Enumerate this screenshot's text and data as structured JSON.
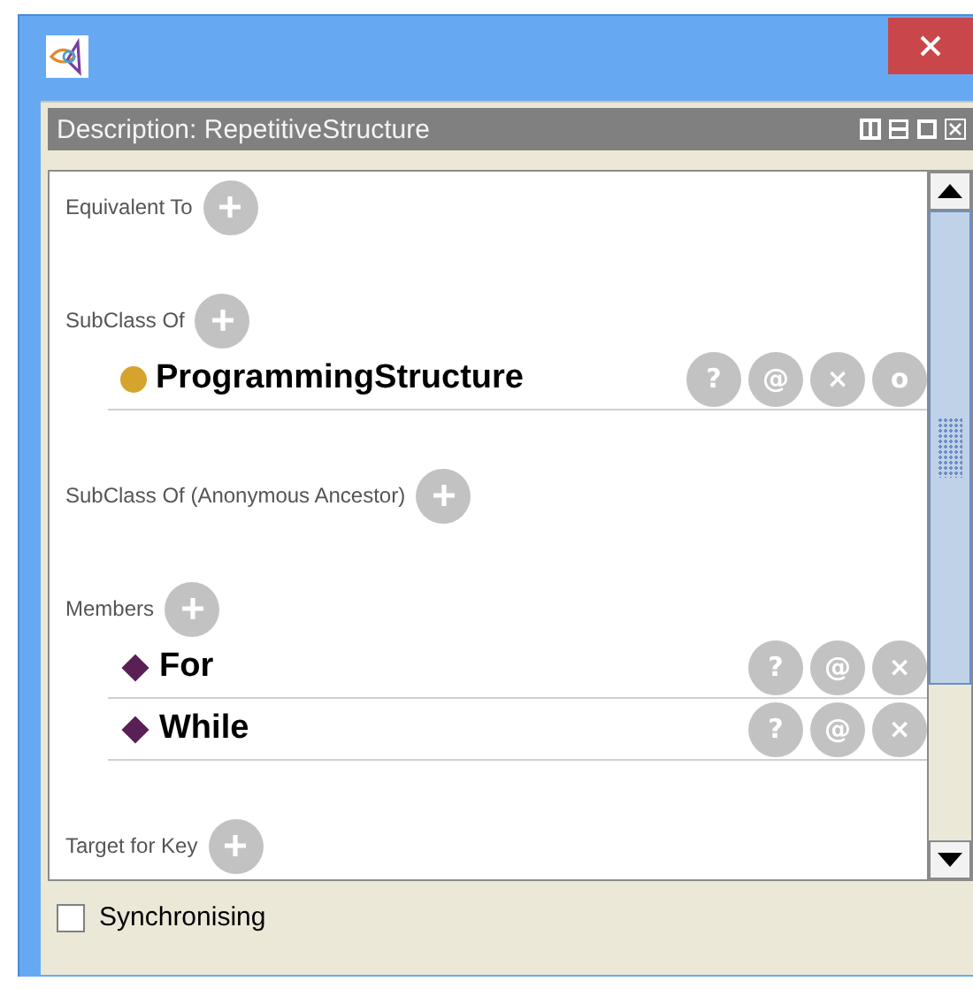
{
  "panel": {
    "title": "Description: RepetitiveStructure"
  },
  "sections": [
    {
      "title": "Equivalent To"
    },
    {
      "title": "SubClass Of",
      "items": [
        {
          "kind": "class",
          "label": "ProgrammingStructure",
          "color": "#d4a42c",
          "buttons": [
            "?",
            "@",
            "×",
            "o"
          ]
        }
      ]
    },
    {
      "title": "SubClass Of (Anonymous Ancestor)"
    },
    {
      "title": "Members",
      "items": [
        {
          "kind": "individual",
          "label": "For",
          "color": "#5a1f55",
          "buttons": [
            "?",
            "@",
            "×"
          ]
        },
        {
          "kind": "individual",
          "label": "While",
          "color": "#5a1f55",
          "buttons": [
            "?",
            "@",
            "×"
          ]
        }
      ]
    },
    {
      "title": "Target for Key"
    }
  ],
  "sync": {
    "label": "Synchronising",
    "checked": false
  }
}
